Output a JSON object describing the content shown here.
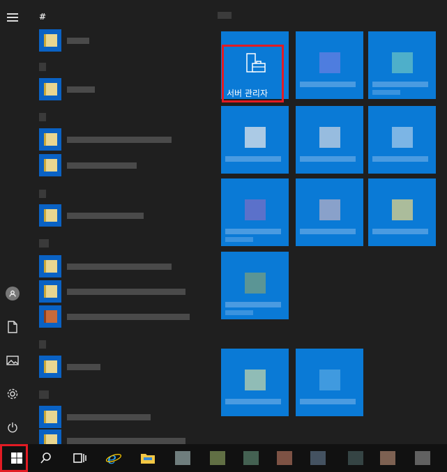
{
  "applist": {
    "first_letter": "#"
  },
  "tiles": {
    "server_manager_label": "서버 관리자"
  },
  "icons": {
    "menu": "hamburger-icon",
    "user": "user-icon",
    "documents": "document-icon",
    "pictures": "pictures-icon",
    "settings": "gear-icon",
    "power": "power-icon",
    "start": "windows-icon",
    "search": "search-icon",
    "task_view": "task-view-icon",
    "edge": "internet-explorer-icon",
    "explorer": "folder-icon"
  },
  "colors": {
    "tile_blue": "#0a7ad6",
    "highlight_red": "#e21b23",
    "background": "#1f1f1f"
  }
}
